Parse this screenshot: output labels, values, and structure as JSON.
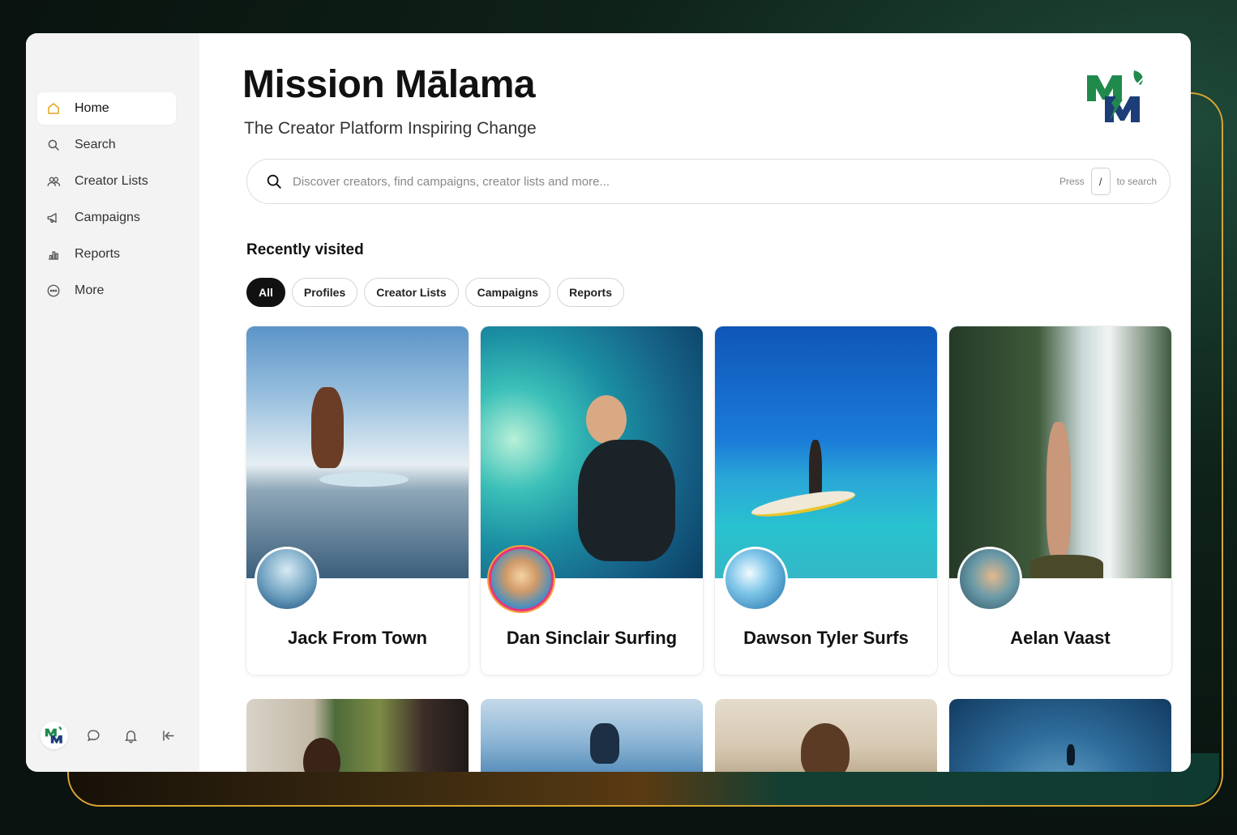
{
  "app": {
    "title": "Mission Mālama",
    "subtitle": "The Creator Platform Inspiring Change",
    "brand_colors": {
      "green": "#1f8a4c",
      "navy": "#1d3d78",
      "accent": "#d8a531"
    }
  },
  "sidebar": {
    "items": [
      {
        "label": "Home",
        "icon": "home-icon",
        "active": true
      },
      {
        "label": "Search",
        "icon": "search-icon",
        "active": false
      },
      {
        "label": "Creator Lists",
        "icon": "users-icon",
        "active": false
      },
      {
        "label": "Campaigns",
        "icon": "megaphone-icon",
        "active": false
      },
      {
        "label": "Reports",
        "icon": "bar-chart-icon",
        "active": false
      },
      {
        "label": "More",
        "icon": "more-icon",
        "active": false
      }
    ],
    "footer": [
      "logo-avatar",
      "chat-icon",
      "bell-icon",
      "collapse-icon"
    ]
  },
  "search": {
    "placeholder": "Discover creators, find campaigns, creator lists and more...",
    "hint_prefix": "Press",
    "hint_key": "/",
    "hint_suffix": "to search"
  },
  "recent": {
    "title": "Recently visited",
    "filters": [
      {
        "label": "All",
        "active": true
      },
      {
        "label": "Profiles",
        "active": false
      },
      {
        "label": "Creator Lists",
        "active": false
      },
      {
        "label": "Campaigns",
        "active": false
      },
      {
        "label": "Reports",
        "active": false
      }
    ],
    "cards": [
      {
        "name": "Jack From Town"
      },
      {
        "name": "Dan Sinclair Surfing"
      },
      {
        "name": "Dawson Tyler Surfs"
      },
      {
        "name": "Aelan Vaast"
      }
    ]
  }
}
